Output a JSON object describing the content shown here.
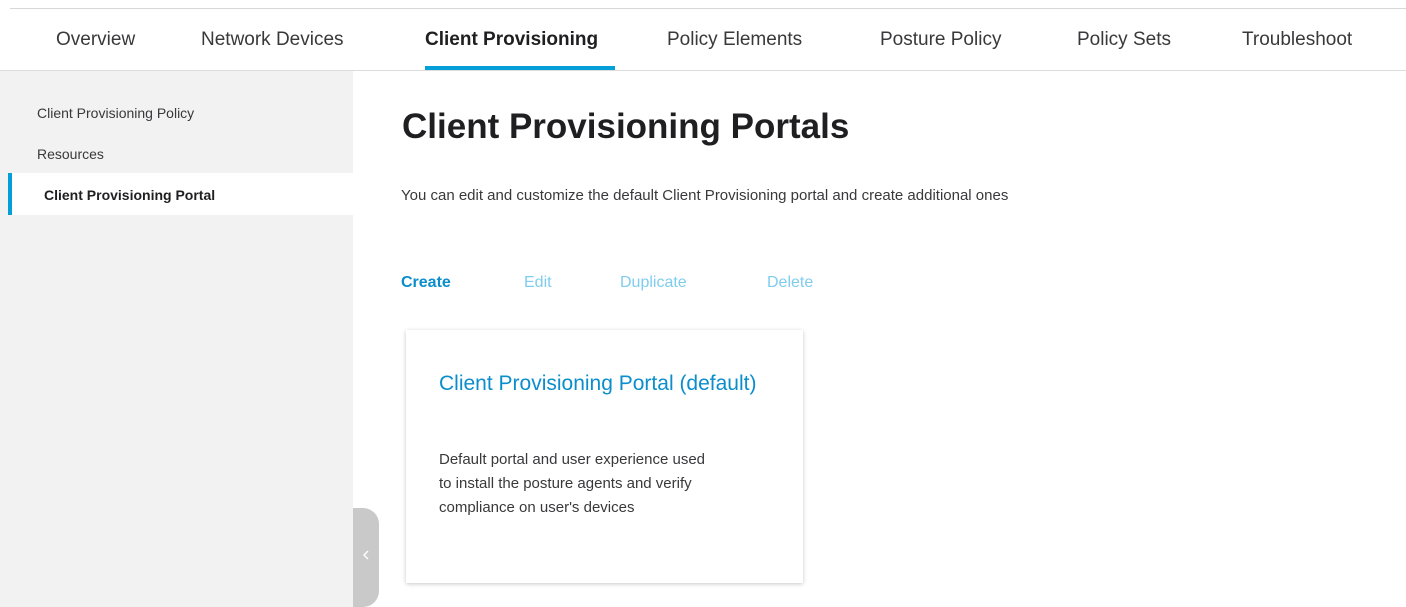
{
  "nav": {
    "tabs": [
      {
        "label": "Overview"
      },
      {
        "label": "Network Devices"
      },
      {
        "label": "Client Provisioning",
        "active": true
      },
      {
        "label": "Policy Elements"
      },
      {
        "label": "Posture Policy"
      },
      {
        "label": "Policy Sets"
      },
      {
        "label": "Troubleshoot"
      }
    ]
  },
  "sidebar": {
    "items": [
      {
        "label": "Client Provisioning Policy"
      },
      {
        "label": "Resources"
      },
      {
        "label": "Client Provisioning Portal",
        "active": true
      }
    ],
    "collapse_icon": "chevron-left-icon"
  },
  "main": {
    "title": "Client Provisioning Portals",
    "description": "You can edit and customize the default Client Provisioning portal and create additional ones",
    "actions": {
      "create": "Create",
      "edit": "Edit",
      "duplicate": "Duplicate",
      "delete": "Delete"
    },
    "card": {
      "title": "Client Provisioning Portal (default)",
      "description": "Default portal and user experience used to install the posture agents and verify compliance on user's devices"
    }
  },
  "colors": {
    "accent": "#049fd9",
    "link": "#0b8ecb",
    "disabled_link": "#7fcdee",
    "sidebar_bg": "#f2f2f2"
  }
}
